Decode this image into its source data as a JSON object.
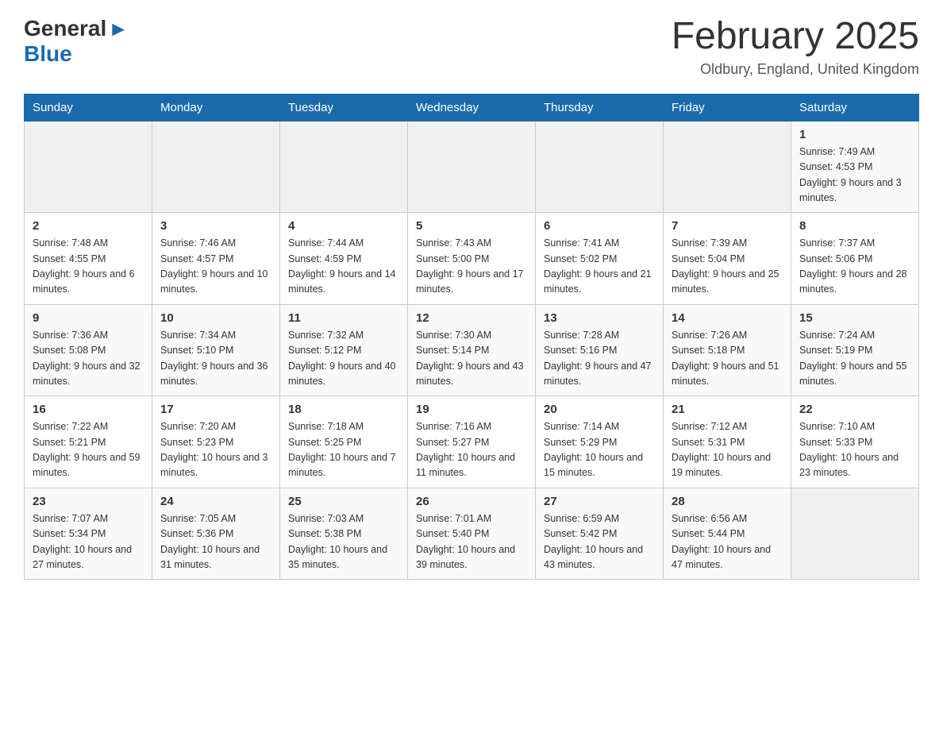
{
  "header": {
    "logo_general": "General",
    "logo_blue": "Blue",
    "month_title": "February 2025",
    "location": "Oldbury, England, United Kingdom"
  },
  "days_of_week": [
    "Sunday",
    "Monday",
    "Tuesday",
    "Wednesday",
    "Thursday",
    "Friday",
    "Saturday"
  ],
  "weeks": [
    [
      {
        "day": "",
        "info": ""
      },
      {
        "day": "",
        "info": ""
      },
      {
        "day": "",
        "info": ""
      },
      {
        "day": "",
        "info": ""
      },
      {
        "day": "",
        "info": ""
      },
      {
        "day": "",
        "info": ""
      },
      {
        "day": "1",
        "info": "Sunrise: 7:49 AM\nSunset: 4:53 PM\nDaylight: 9 hours and 3 minutes."
      }
    ],
    [
      {
        "day": "2",
        "info": "Sunrise: 7:48 AM\nSunset: 4:55 PM\nDaylight: 9 hours and 6 minutes."
      },
      {
        "day": "3",
        "info": "Sunrise: 7:46 AM\nSunset: 4:57 PM\nDaylight: 9 hours and 10 minutes."
      },
      {
        "day": "4",
        "info": "Sunrise: 7:44 AM\nSunset: 4:59 PM\nDaylight: 9 hours and 14 minutes."
      },
      {
        "day": "5",
        "info": "Sunrise: 7:43 AM\nSunset: 5:00 PM\nDaylight: 9 hours and 17 minutes."
      },
      {
        "day": "6",
        "info": "Sunrise: 7:41 AM\nSunset: 5:02 PM\nDaylight: 9 hours and 21 minutes."
      },
      {
        "day": "7",
        "info": "Sunrise: 7:39 AM\nSunset: 5:04 PM\nDaylight: 9 hours and 25 minutes."
      },
      {
        "day": "8",
        "info": "Sunrise: 7:37 AM\nSunset: 5:06 PM\nDaylight: 9 hours and 28 minutes."
      }
    ],
    [
      {
        "day": "9",
        "info": "Sunrise: 7:36 AM\nSunset: 5:08 PM\nDaylight: 9 hours and 32 minutes."
      },
      {
        "day": "10",
        "info": "Sunrise: 7:34 AM\nSunset: 5:10 PM\nDaylight: 9 hours and 36 minutes."
      },
      {
        "day": "11",
        "info": "Sunrise: 7:32 AM\nSunset: 5:12 PM\nDaylight: 9 hours and 40 minutes."
      },
      {
        "day": "12",
        "info": "Sunrise: 7:30 AM\nSunset: 5:14 PM\nDaylight: 9 hours and 43 minutes."
      },
      {
        "day": "13",
        "info": "Sunrise: 7:28 AM\nSunset: 5:16 PM\nDaylight: 9 hours and 47 minutes."
      },
      {
        "day": "14",
        "info": "Sunrise: 7:26 AM\nSunset: 5:18 PM\nDaylight: 9 hours and 51 minutes."
      },
      {
        "day": "15",
        "info": "Sunrise: 7:24 AM\nSunset: 5:19 PM\nDaylight: 9 hours and 55 minutes."
      }
    ],
    [
      {
        "day": "16",
        "info": "Sunrise: 7:22 AM\nSunset: 5:21 PM\nDaylight: 9 hours and 59 minutes."
      },
      {
        "day": "17",
        "info": "Sunrise: 7:20 AM\nSunset: 5:23 PM\nDaylight: 10 hours and 3 minutes."
      },
      {
        "day": "18",
        "info": "Sunrise: 7:18 AM\nSunset: 5:25 PM\nDaylight: 10 hours and 7 minutes."
      },
      {
        "day": "19",
        "info": "Sunrise: 7:16 AM\nSunset: 5:27 PM\nDaylight: 10 hours and 11 minutes."
      },
      {
        "day": "20",
        "info": "Sunrise: 7:14 AM\nSunset: 5:29 PM\nDaylight: 10 hours and 15 minutes."
      },
      {
        "day": "21",
        "info": "Sunrise: 7:12 AM\nSunset: 5:31 PM\nDaylight: 10 hours and 19 minutes."
      },
      {
        "day": "22",
        "info": "Sunrise: 7:10 AM\nSunset: 5:33 PM\nDaylight: 10 hours and 23 minutes."
      }
    ],
    [
      {
        "day": "23",
        "info": "Sunrise: 7:07 AM\nSunset: 5:34 PM\nDaylight: 10 hours and 27 minutes."
      },
      {
        "day": "24",
        "info": "Sunrise: 7:05 AM\nSunset: 5:36 PM\nDaylight: 10 hours and 31 minutes."
      },
      {
        "day": "25",
        "info": "Sunrise: 7:03 AM\nSunset: 5:38 PM\nDaylight: 10 hours and 35 minutes."
      },
      {
        "day": "26",
        "info": "Sunrise: 7:01 AM\nSunset: 5:40 PM\nDaylight: 10 hours and 39 minutes."
      },
      {
        "day": "27",
        "info": "Sunrise: 6:59 AM\nSunset: 5:42 PM\nDaylight: 10 hours and 43 minutes."
      },
      {
        "day": "28",
        "info": "Sunrise: 6:56 AM\nSunset: 5:44 PM\nDaylight: 10 hours and 47 minutes."
      },
      {
        "day": "",
        "info": ""
      }
    ]
  ]
}
